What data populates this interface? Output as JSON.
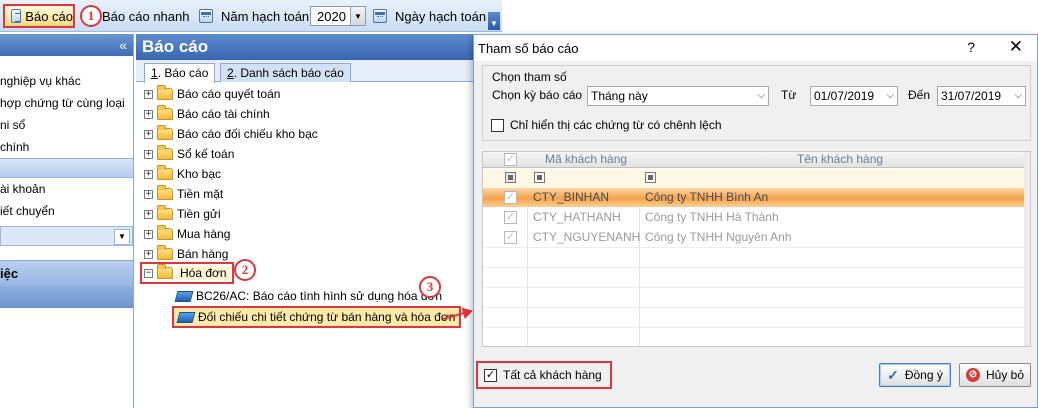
{
  "toolbar": {
    "bao_cao": "Báo cáo",
    "bao_cao_nhanh": "Báo cáo nhanh",
    "nam_hach_toan": "Năm hạch toán",
    "year": "2020",
    "ngay_hach_toan": "Ngày hạch toán"
  },
  "callouts": [
    "1",
    "2",
    "3"
  ],
  "left_panel": {
    "collapse_glyph": "«",
    "items": [
      "nghiệp vụ khác",
      "hợp chứng từ cùng loại",
      "ni sổ",
      "chính"
    ],
    "items2": [
      "ài khoản",
      "iết chuyển"
    ],
    "section": "iệc"
  },
  "report_area": {
    "title": "Báo cáo",
    "tabs": [
      {
        "num": "1",
        "label": ". Báo cáo"
      },
      {
        "num": "2",
        "label": ". Danh sách báo cáo"
      }
    ],
    "tree": [
      "Báo cáo quyết toán",
      "Báo cáo tài chính",
      "Báo cáo đối chiếu kho bạc",
      "Sổ kế toán",
      "Kho bạc",
      "Tiền mặt",
      "Tiền gửi",
      "Mua hàng",
      "Bán hàng",
      "Hóa đơn"
    ],
    "children": [
      "BC26/AC: Báo cáo tình hình sử dụng hóa đơn",
      "Đối chiếu chi tiết chứng từ bán hàng và hóa đơn"
    ]
  },
  "dialog": {
    "title": "Tham số báo cáo",
    "help": "?",
    "close": "✕",
    "group_label": "Chọn tham số",
    "period_label": "Chọn kỳ báo cáo",
    "period_value": "Tháng này",
    "from_label": "Từ",
    "from_value": "01/07/2019",
    "to_label": "Đến",
    "to_value": "31/07/2019",
    "diff_only": "Chỉ hiển thị các chứng từ có chênh lệch",
    "columns": [
      "Mã khách hàng",
      "Tên khách hàng"
    ],
    "rows": [
      {
        "code": "CTY_BINHAN",
        "name": "Công ty TNHH Bình An"
      },
      {
        "code": "CTY_HATHANH",
        "name": "Công ty TNHH Hà Thành"
      },
      {
        "code": "CTY_NGUYENANH",
        "name": "Công ty TNHH Nguyên Anh"
      }
    ],
    "all_customers": "Tất cả khách hàng",
    "ok": "Đồng ý",
    "cancel": "Hủy bỏ"
  }
}
